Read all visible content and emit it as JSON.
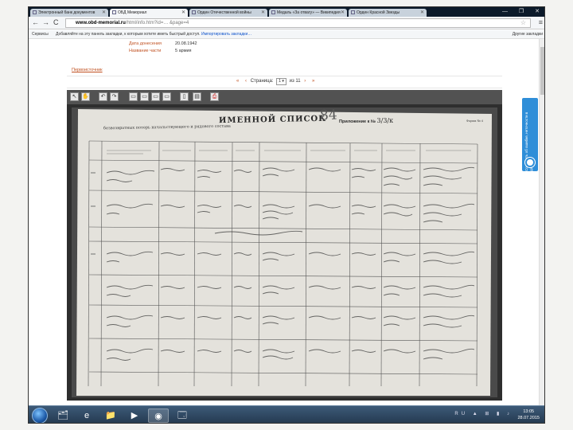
{
  "browser": {
    "tabs": [
      {
        "label": "Электронный банк документов",
        "active": false
      },
      {
        "label": "ОБД Мемориал",
        "active": true
      },
      {
        "label": "Орден Отечественной войны",
        "active": false
      },
      {
        "label": "Медаль «За отвагу» — Википедия",
        "active": false
      },
      {
        "label": "Орден Красной Звезды",
        "active": false
      }
    ],
    "tab_close": "✕",
    "window_controls": "—  ❐  ✕",
    "back": "←",
    "forward": "→",
    "reload": "C",
    "url_host": "www.obd-memorial.ru",
    "url_path": "/html/info.htm?id=… &page=4",
    "star": "☆",
    "menu": "≡",
    "bookmarks_apps": "Сервисы",
    "bookmarks_hint_pre": "Добавляйте на эту панель закладки, к которым хотите иметь быстрый доступ.",
    "bookmarks_hint_link": "Импортировать закладки…",
    "bookmarks_other": "Другие закладки"
  },
  "page": {
    "fields": [
      {
        "key": "Дата донесения",
        "value": "20.08.1942"
      },
      {
        "key": "Название части",
        "value": "5 армия"
      }
    ],
    "back_link": "Первоисточник",
    "pager": {
      "first": "«",
      "prev": "‹",
      "label": "Страница:",
      "current": "1",
      "of": "из 11",
      "next": "›",
      "last": "»"
    },
    "viewer_tools": [
      "↖",
      "✋",
      "↶",
      "↷",
      "▭",
      "▭",
      "▭",
      "▭",
      "▯",
      "▤",
      "⎙"
    ],
    "doc": {
      "title": "ИМЕННОЙ СПИСОК",
      "caption": "безвозвратных потерь начальствующего и рядового состава",
      "number": "84",
      "prilog": "Приложение к №",
      "prilog_hw": "3/3/к",
      "form": "Форма № 4"
    },
    "feedback_label": "Сообщить об ошибке, неточности в данных"
  },
  "taskbar": {
    "items": [
      "🗂",
      "e",
      "📁",
      "▶",
      "◉",
      "🗔"
    ],
    "tray": "RU ▲ ⊞ ▮ ♪",
    "time": "13:05",
    "date": "28.07.2015"
  }
}
